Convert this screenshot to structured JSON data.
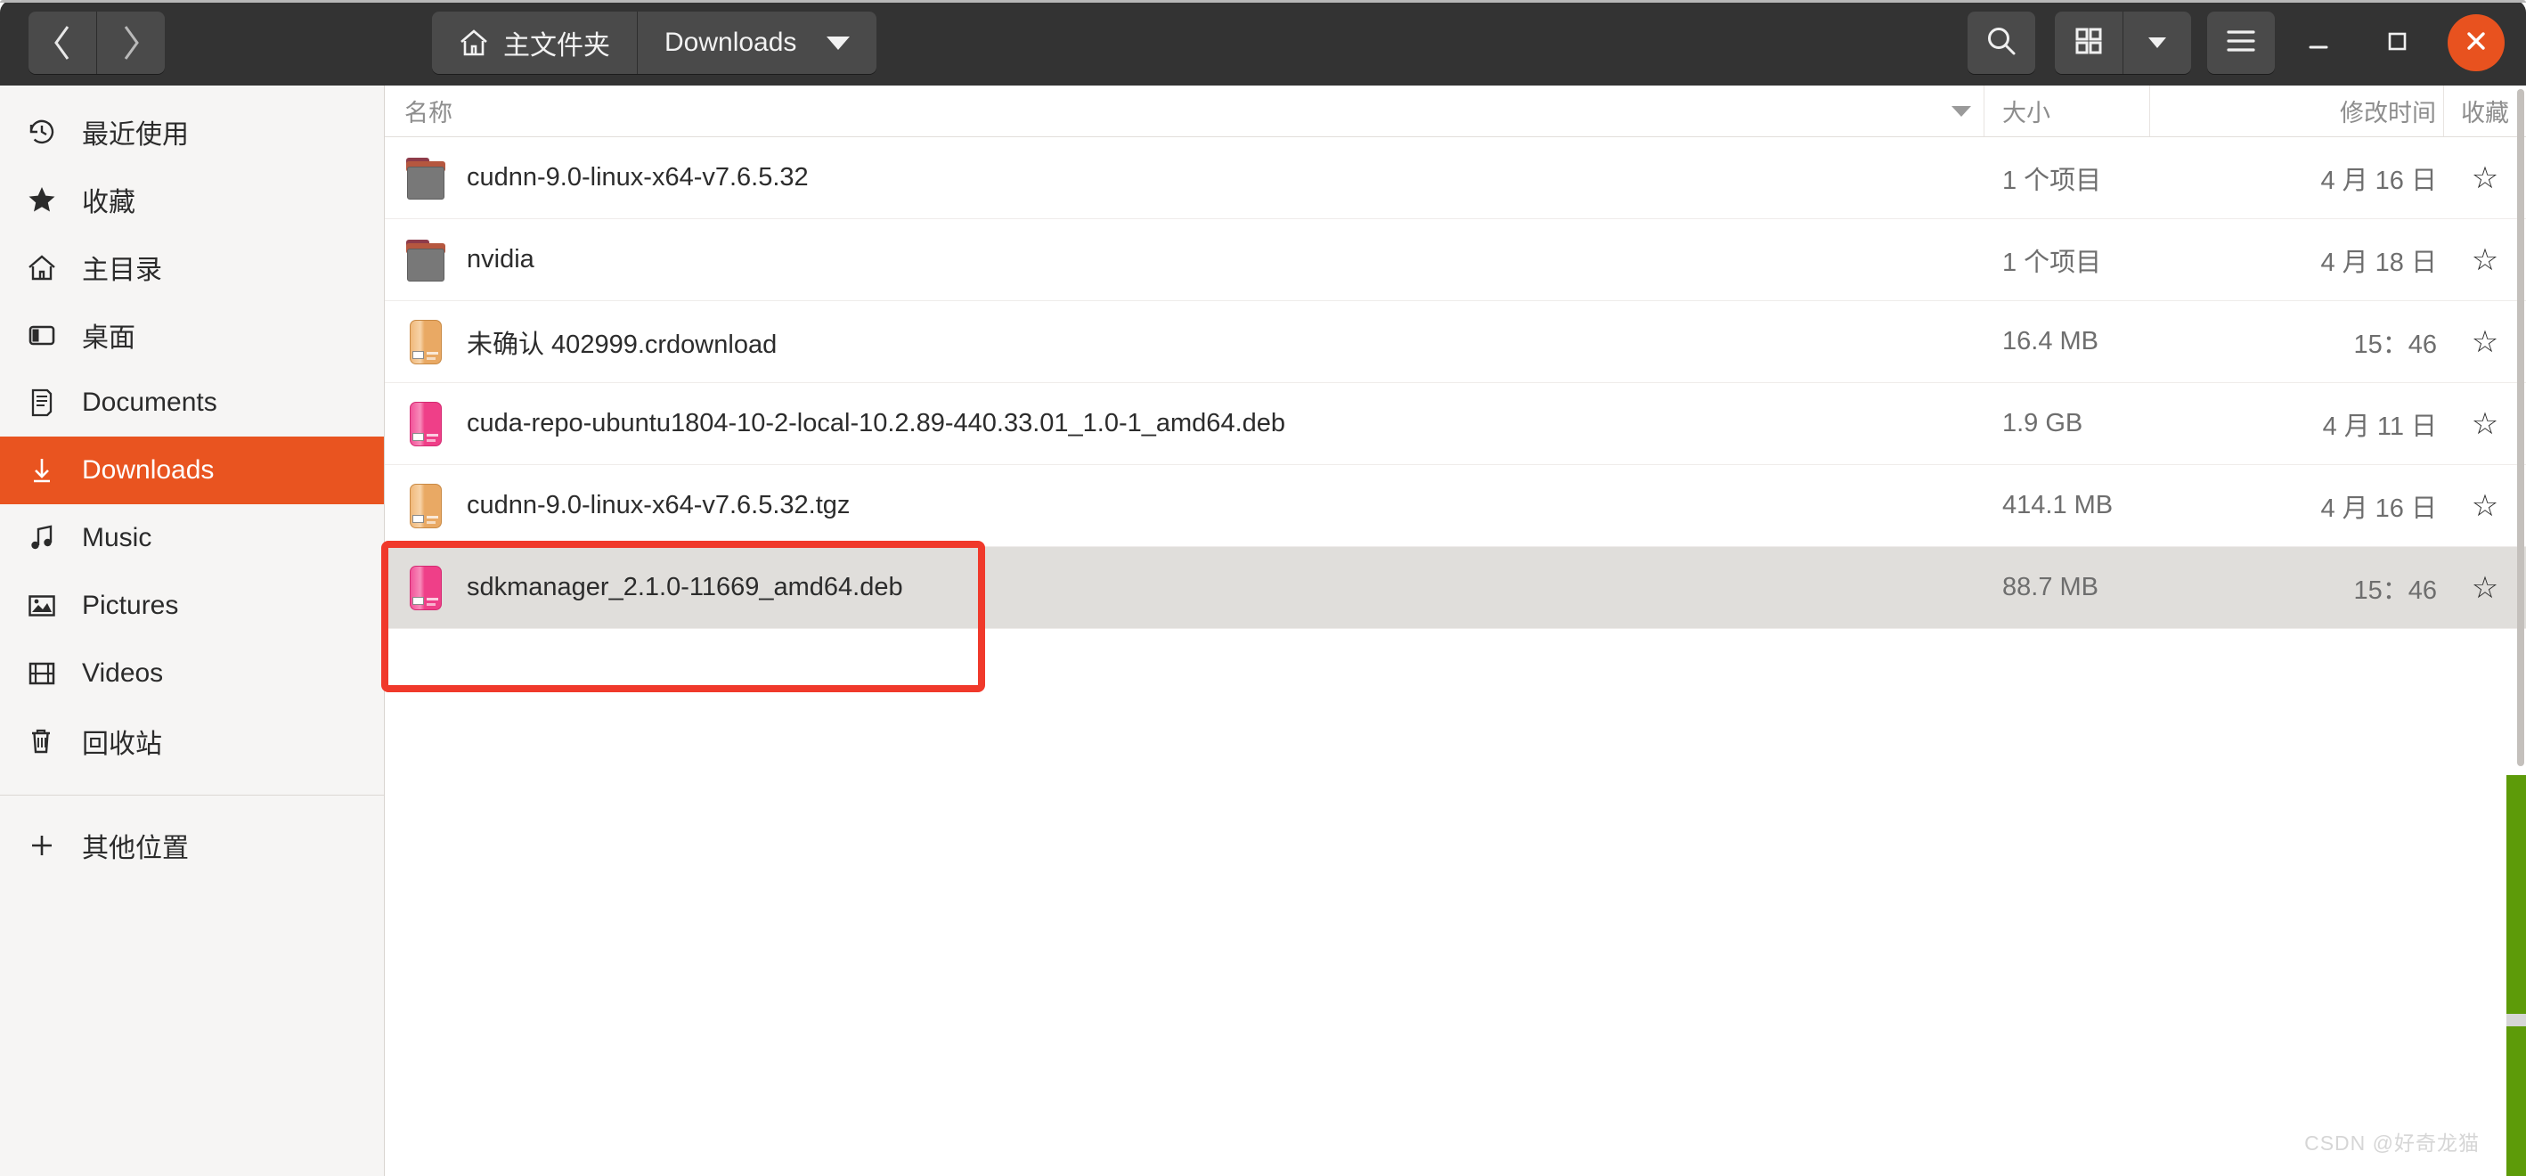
{
  "window": {
    "close_label": "✕"
  },
  "titlebar": {
    "nav": {
      "back_label": "‹",
      "forward_label": "›"
    },
    "breadcrumb": [
      {
        "label": "主文件夹",
        "icon": "home-icon",
        "has_caret": false
      },
      {
        "label": "Downloads",
        "icon": "",
        "has_caret": true
      }
    ],
    "buttons": {
      "search": "search-icon",
      "grid_view": "grid-view-icon",
      "view_dropdown": "chevron-down-icon",
      "menu": "hamburger-menu-icon",
      "minimize": "minimize-icon",
      "maximize": "maximize-icon",
      "close": "close-icon"
    }
  },
  "sidebar": {
    "items": [
      {
        "label": "最近使用",
        "icon": "clock-history-icon",
        "active": false
      },
      {
        "label": "收藏",
        "icon": "star-icon",
        "active": false
      },
      {
        "label": "主目录",
        "icon": "home-icon",
        "active": false
      },
      {
        "label": "桌面",
        "icon": "desktop-icon",
        "active": false
      },
      {
        "label": "Documents",
        "icon": "document-icon",
        "active": false
      },
      {
        "label": "Downloads",
        "icon": "download-icon",
        "active": true
      },
      {
        "label": "Music",
        "icon": "music-note-icon",
        "active": false
      },
      {
        "label": "Pictures",
        "icon": "picture-icon",
        "active": false
      },
      {
        "label": "Videos",
        "icon": "film-icon",
        "active": false
      },
      {
        "label": "回收站",
        "icon": "trash-icon",
        "active": false
      }
    ],
    "other_locations": {
      "label": "其他位置",
      "icon": "plus-icon"
    }
  },
  "filelist": {
    "columns": {
      "name": "名称",
      "size": "大小",
      "modified": "修改时间",
      "favorite": "收藏"
    },
    "sort_column": "name",
    "rows": [
      {
        "name": "cudnn-9.0-linux-x64-v7.6.5.32",
        "icon": "folder-icon",
        "kind": "folder",
        "size": "1 个项目",
        "modified": "4 月 16 日",
        "star": "☆",
        "selected": false
      },
      {
        "name": "nvidia",
        "icon": "folder-icon",
        "kind": "folder",
        "size": "1 个项目",
        "modified": "4 月 18 日",
        "star": "☆",
        "selected": false
      },
      {
        "name": "未确认 402999.crdownload",
        "icon": "package-icon",
        "kind": "package-orange",
        "size": "16.4 MB",
        "modified": "15：46",
        "star": "☆",
        "selected": false
      },
      {
        "name": "cuda-repo-ubuntu1804-10-2-local-10.2.89-440.33.01_1.0-1_amd64.deb",
        "icon": "package-icon",
        "kind": "package-pink",
        "size": "1.9 GB",
        "modified": "4 月 11 日",
        "star": "☆",
        "selected": false
      },
      {
        "name": "cudnn-9.0-linux-x64-v7.6.5.32.tgz",
        "icon": "package-icon",
        "kind": "package-orange",
        "size": "414.1 MB",
        "modified": "4 月 16 日",
        "star": "☆",
        "selected": false
      },
      {
        "name": "sdkmanager_2.1.0-11669_amd64.deb",
        "icon": "package-icon",
        "kind": "package-pink",
        "size": "88.7 MB",
        "modified": "15：46",
        "star": "☆",
        "selected": true
      }
    ]
  },
  "annotation": {
    "color": "#f0392b",
    "target_row": "sdkmanager_2.1.0-11669_amd64.deb"
  },
  "watermark": {
    "text": "CSDN @好奇龙猫"
  },
  "colors": {
    "accent": "#e95420",
    "titlebar_bg": "#333333",
    "sidebar_bg": "#f6f5f4",
    "selection_bg": "#e0dedb",
    "annotation_red": "#f0392b",
    "edge_green": "#5d9b09"
  }
}
